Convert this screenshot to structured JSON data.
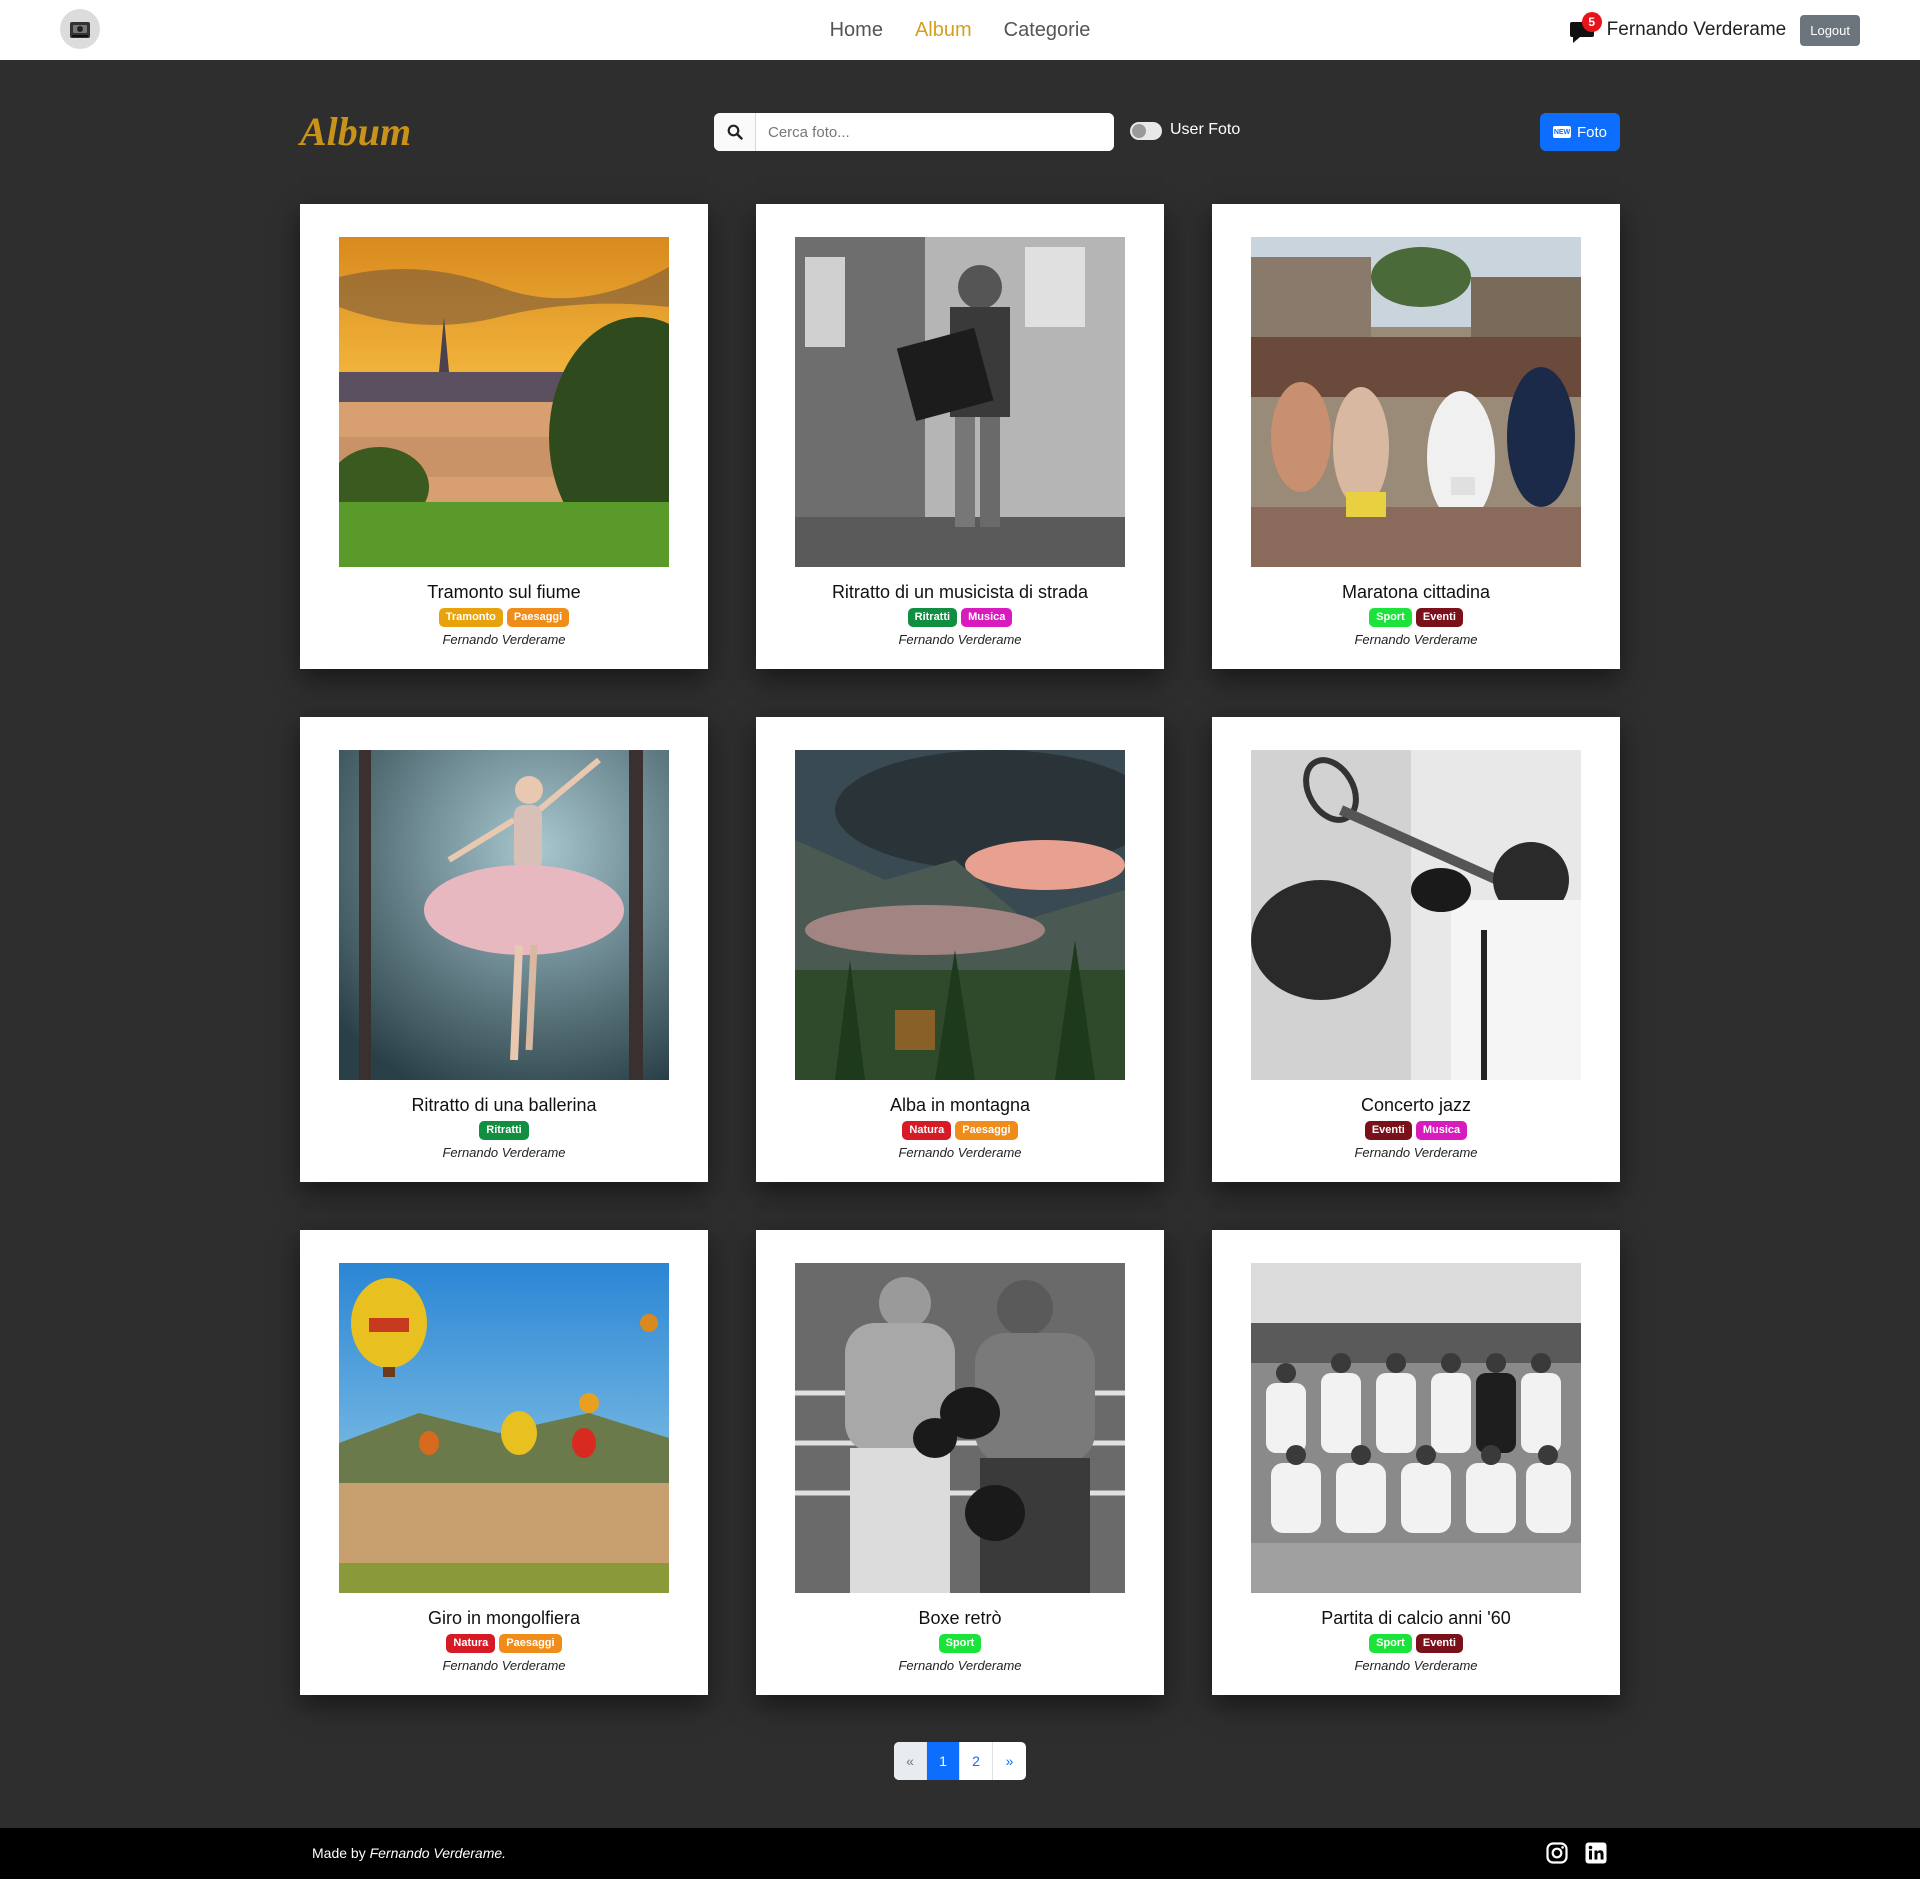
{
  "nav": {
    "brand_icon": "gramophone-icon",
    "links": [
      "Home",
      "Album",
      "Categorie"
    ],
    "active": "Album",
    "messages_count": "5",
    "user_name": "Fernando Verderame",
    "logout_label": "Logout"
  },
  "header": {
    "title": "Album",
    "search_placeholder": "Cerca foto...",
    "toggle_label": "User Foto",
    "toggle_on": false,
    "new_badge": "NEW",
    "add_button_label": "Foto"
  },
  "colors": {
    "accent": "#d4a11e",
    "primary": "#0d6efd",
    "background": "#2e2e2e",
    "tag_tramonto": "#e8a20c",
    "tag_paesaggi": "#f08c1a",
    "tag_ritratti": "#0f8f3f",
    "tag_musica": "#d81bbd",
    "tag_sport": "#1be33a",
    "tag_eventi": "#7a1019",
    "tag_natura": "#d61a26"
  },
  "photos": [
    {
      "title": "Tramonto sul fiume",
      "tags": [
        {
          "label": "Tramonto",
          "color": "#e8a20c"
        },
        {
          "label": "Paesaggi",
          "color": "#f08c1a"
        }
      ],
      "author": "Fernando Verderame",
      "image": "sunset-river"
    },
    {
      "title": "Ritratto di un musicista di strada",
      "tags": [
        {
          "label": "Ritratti",
          "color": "#0f8f3f"
        },
        {
          "label": "Musica",
          "color": "#d81bbd"
        }
      ],
      "author": "Fernando Verderame",
      "image": "street-musician"
    },
    {
      "title": "Maratona cittadina",
      "tags": [
        {
          "label": "Sport",
          "color": "#1be33a"
        },
        {
          "label": "Eventi",
          "color": "#7a1019"
        }
      ],
      "author": "Fernando Verderame",
      "image": "marathon"
    },
    {
      "title": "Ritratto di una ballerina",
      "tags": [
        {
          "label": "Ritratti",
          "color": "#0f8f3f"
        }
      ],
      "author": "Fernando Verderame",
      "image": "ballerina"
    },
    {
      "title": "Alba in montagna",
      "tags": [
        {
          "label": "Natura",
          "color": "#d61a26"
        },
        {
          "label": "Paesaggi",
          "color": "#f08c1a"
        }
      ],
      "author": "Fernando Verderame",
      "image": "mountain-dawn"
    },
    {
      "title": "Concerto jazz",
      "tags": [
        {
          "label": "Eventi",
          "color": "#7a1019"
        },
        {
          "label": "Musica",
          "color": "#d81bbd"
        }
      ],
      "author": "Fernando Verderame",
      "image": "jazz-trumpet"
    },
    {
      "title": "Giro in mongolfiera",
      "tags": [
        {
          "label": "Natura",
          "color": "#d61a26"
        },
        {
          "label": "Paesaggi",
          "color": "#f08c1a"
        }
      ],
      "author": "Fernando Verderame",
      "image": "balloons"
    },
    {
      "title": "Boxe retrò",
      "tags": [
        {
          "label": "Sport",
          "color": "#1be33a"
        }
      ],
      "author": "Fernando Verderame",
      "image": "boxing"
    },
    {
      "title": "Partita di calcio anni '60",
      "tags": [
        {
          "label": "Sport",
          "color": "#1be33a"
        },
        {
          "label": "Eventi",
          "color": "#7a1019"
        }
      ],
      "author": "Fernando Verderame",
      "image": "football-team"
    }
  ],
  "pagination": {
    "prev": "«",
    "pages": [
      "1",
      "2"
    ],
    "current": "1",
    "next": "»"
  },
  "footer": {
    "made_by": "Made by",
    "author": "Fernando Verderame.",
    "social": [
      "instagram-icon",
      "linkedin-icon"
    ]
  }
}
